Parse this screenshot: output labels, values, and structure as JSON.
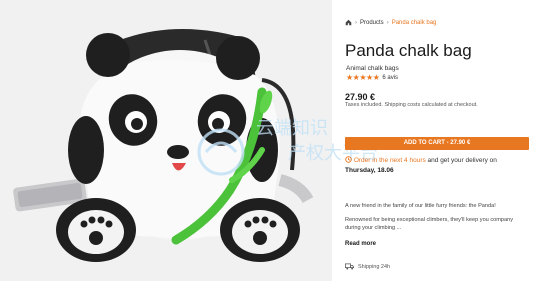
{
  "breadcrumb": {
    "home_icon": "home-icon",
    "items": [
      "Products",
      "Panda chalk bag"
    ]
  },
  "product": {
    "title": "Panda chalk bag",
    "subtitle": "Animal chalk bags",
    "rating": {
      "stars": "★★★★★",
      "value": 5,
      "count_label": "6 avis"
    },
    "price": "27.90 €",
    "tax_note": "Taxes included. Shipping costs calculated at checkout.",
    "cart_button": "ADD TO CART - 27.90 €",
    "delivery": {
      "prefix": "Order in the next ",
      "hours": "4 hours",
      "suffix": " and get your delivery on",
      "date": "Thursday, 18.06"
    },
    "description": [
      "A new friend in the family of our little furry friends: the Panda!",
      "Renowned for being exceptional climbers, they'll keep you company",
      "during your climbing ..."
    ],
    "read_more": "Read more",
    "shipping": "Shipping 24h"
  },
  "colors": {
    "accent": "#e87722",
    "image_bg": "#f1f1f2"
  },
  "watermark": {
    "line1": "云端知识",
    "line2": "产权大平台"
  }
}
